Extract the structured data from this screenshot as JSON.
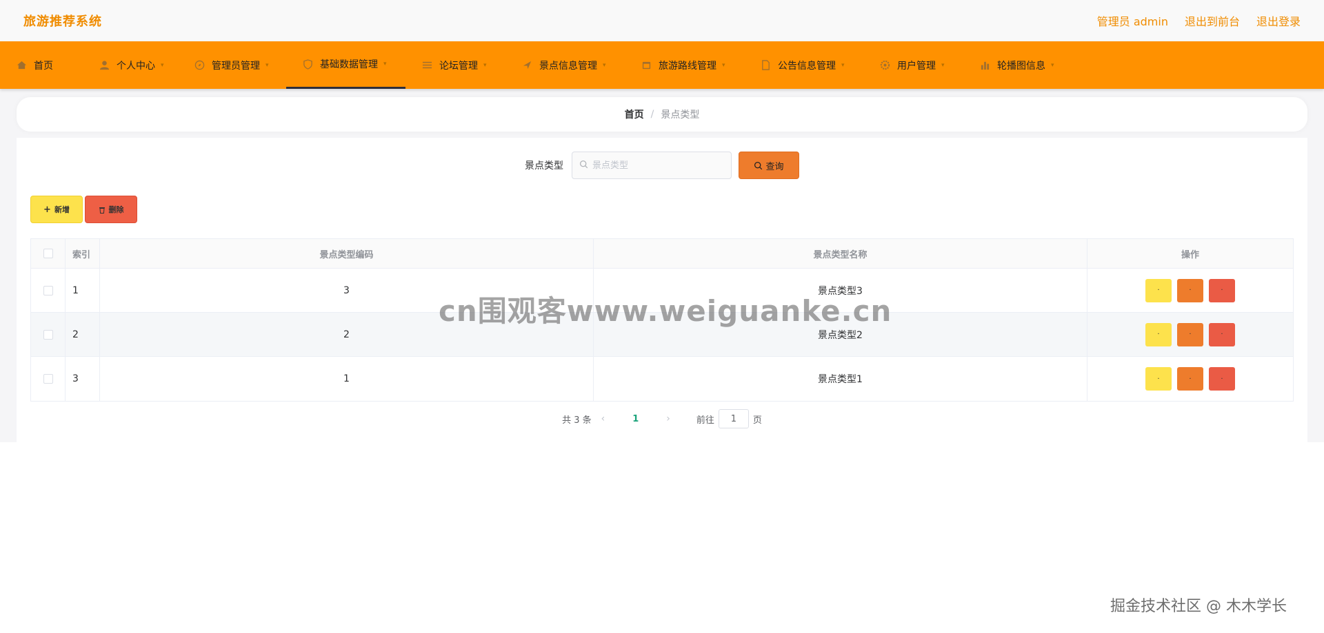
{
  "header": {
    "brand": "旅游推荐系统",
    "links": [
      "管理员 admin",
      "退出到前台",
      "退出登录"
    ]
  },
  "nav": {
    "items": [
      {
        "label": "首页",
        "icon": "home-icon",
        "caret": false,
        "active": false
      },
      {
        "label": "个人中心",
        "icon": "user-icon",
        "caret": true,
        "active": false
      },
      {
        "label": "管理员管理",
        "icon": "compass-icon",
        "caret": true,
        "active": false
      },
      {
        "label": "基础数据管理",
        "icon": "shield-icon",
        "caret": true,
        "active": true
      },
      {
        "label": "论坛管理",
        "icon": "list-icon",
        "caret": true,
        "active": false
      },
      {
        "label": "景点信息管理",
        "icon": "pin-icon",
        "caret": true,
        "active": false
      },
      {
        "label": "旅游路线管理",
        "icon": "calendar-icon",
        "caret": true,
        "active": false
      },
      {
        "label": "公告信息管理",
        "icon": "document-icon",
        "caret": true,
        "active": false
      },
      {
        "label": "用户管理",
        "icon": "gear-icon",
        "caret": true,
        "active": false
      },
      {
        "label": "轮播图信息",
        "icon": "chart-icon",
        "caret": true,
        "active": false
      }
    ]
  },
  "breadcrumb": {
    "home": "首页",
    "separator": "/",
    "current": "景点类型"
  },
  "search": {
    "label": "景点类型",
    "placeholder": "景点类型",
    "value": "",
    "button": "查询"
  },
  "actions": {
    "add": "新增",
    "delete": "删除"
  },
  "table": {
    "columns": [
      "索引",
      "景点类型编码",
      "景点类型名称",
      "操作"
    ],
    "rows": [
      {
        "index": "1",
        "code": "3",
        "name": "景点类型3"
      },
      {
        "index": "2",
        "code": "2",
        "name": "景点类型2"
      },
      {
        "index": "3",
        "code": "1",
        "name": "景点类型1"
      }
    ],
    "op_label": "·"
  },
  "pagination": {
    "total": "共 3 条",
    "current": "1",
    "goto_label": "前往",
    "goto_value": "1",
    "page_suffix": "页"
  },
  "watermarks": {
    "center": "cn围观客www.weiguanke.cn",
    "bottom": "掘金技术社区 @ 木木学长"
  },
  "colors": {
    "brand": "#f08c00",
    "navbar": "#ff9100",
    "query": "#ee7c2c",
    "add": "#fde24c",
    "delete": "#ee5f45",
    "pager_active": "#1aa37a"
  }
}
